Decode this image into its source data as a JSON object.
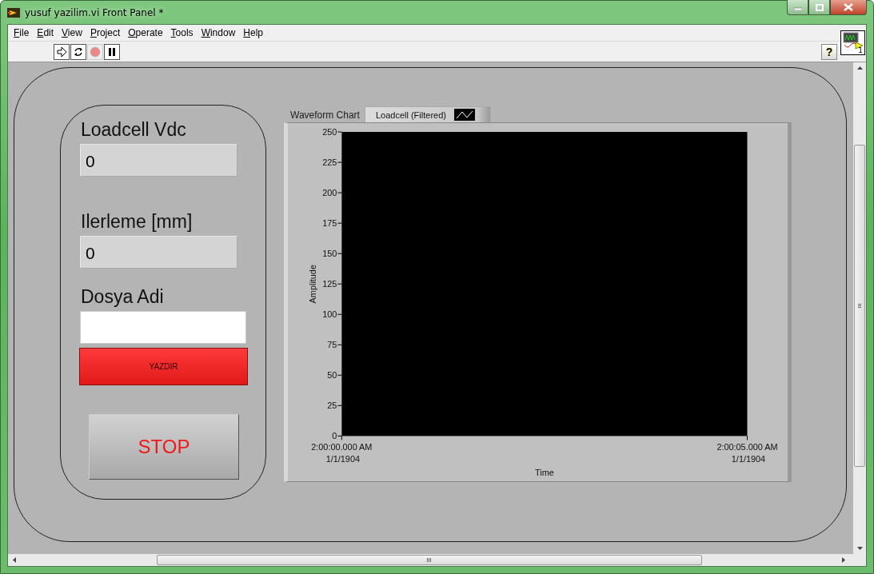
{
  "window": {
    "title": "yusuf yazilim.vi Front Panel *"
  },
  "menu": [
    {
      "label": "File"
    },
    {
      "label": "Edit"
    },
    {
      "label": "View"
    },
    {
      "label": "Project"
    },
    {
      "label": "Operate"
    },
    {
      "label": "Tools"
    },
    {
      "label": "Window"
    },
    {
      "label": "Help"
    }
  ],
  "toolbar": {
    "help_button": "?",
    "connector_number": "1"
  },
  "panel": {
    "indicators": [
      {
        "label": "Loadcell Vdc",
        "value": "0"
      },
      {
        "label": "Ilerleme [mm]",
        "value": "0"
      }
    ],
    "file_name": {
      "label": "Dosya Adi"
    },
    "print_button": "YAZDIR",
    "stop_button": "STOP",
    "chart": {
      "legend": "Loadcell (Filtered)",
      "chart_data": {
        "type": "line",
        "title": "Waveform Chart",
        "xlabel": "Time",
        "ylabel": "Amplitude",
        "ylim": [
          0,
          250
        ],
        "yticks": [
          0,
          25,
          50,
          75,
          100,
          125,
          150,
          175,
          200,
          225,
          250
        ],
        "categories": [
          "2:00:00.000 AM 1/1/1904",
          "2:00:05.000 AM 1/1/1904"
        ]
      }
    }
  }
}
